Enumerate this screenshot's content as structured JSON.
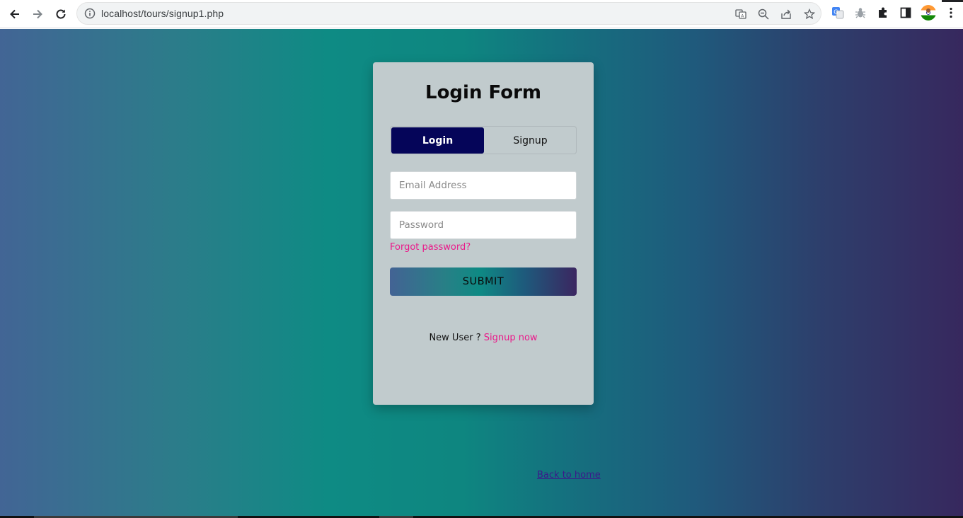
{
  "browser": {
    "url": "localhost/tours/signup1.php",
    "icons": [
      "back-icon",
      "forward-icon",
      "reload-icon",
      "info-icon",
      "translate-icon",
      "zoom-icon",
      "share-icon",
      "bookmark-star-icon",
      "google-translate-extension-icon",
      "bug-extension-icon",
      "extensions-puzzle-icon",
      "side-panel-icon",
      "profile-avatar",
      "menu-kebab-icon"
    ]
  },
  "page": {
    "background_gradient": [
      "#426595",
      "#0e8b84",
      "#37285e"
    ]
  },
  "form": {
    "title": "Login Form",
    "tabs": [
      {
        "label": "Login",
        "active": true
      },
      {
        "label": "Signup",
        "active": false
      }
    ],
    "email": {
      "placeholder": "Email Address",
      "value": ""
    },
    "password": {
      "placeholder": "Password",
      "value": ""
    },
    "forgot_link": "Forgot password?",
    "submit_label": "SUBMIT",
    "new_user_text": "New User ?",
    "signup_link": "Signup now",
    "accent_color": "#ea1a8a",
    "active_tab_color": "#050559"
  },
  "footer": {
    "back_home_link": "Back to home"
  }
}
